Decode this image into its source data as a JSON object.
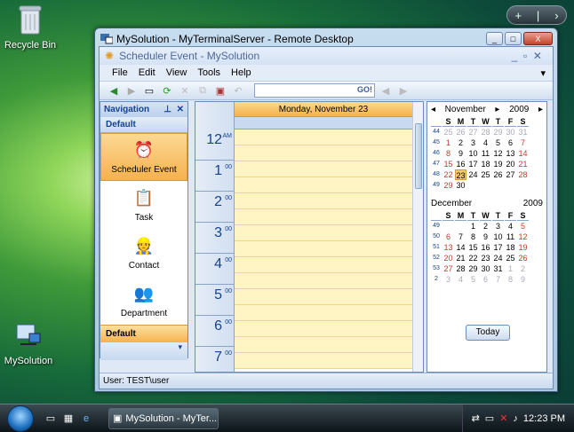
{
  "desktop": {
    "recycle_label": "Recycle Bin",
    "app_icon_label": "MySolution"
  },
  "gadget": {
    "add": "+",
    "sep": "|",
    "more": "›"
  },
  "rd_window": {
    "title": "MySolution - MyTerminalServer - Remote Desktop",
    "min": "_",
    "max": "□",
    "close": "X"
  },
  "app": {
    "title": "Scheduler Event - MySolution",
    "menu": [
      "File",
      "Edit",
      "View",
      "Tools",
      "Help"
    ],
    "search_go": "GO!",
    "status": "User: TEST\\user"
  },
  "navigation": {
    "title": "Navigation",
    "pin": "ᵖ",
    "close": "✕",
    "group": "Default",
    "group2": "Default",
    "items": [
      {
        "label": "Scheduler Event",
        "icon": "alarm-clock-icon"
      },
      {
        "label": "Task",
        "icon": "clipboard-icon"
      },
      {
        "label": "Contact",
        "icon": "person-icon"
      },
      {
        "label": "Department",
        "icon": "people-icon"
      }
    ]
  },
  "scheduler": {
    "day_header": "Monday, November 23",
    "hours": [
      {
        "h": "12",
        "s": "AM"
      },
      {
        "h": "1",
        "s": "00"
      },
      {
        "h": "2",
        "s": "00"
      },
      {
        "h": "3",
        "s": "00"
      },
      {
        "h": "4",
        "s": "00"
      },
      {
        "h": "5",
        "s": "00"
      },
      {
        "h": "6",
        "s": "00"
      },
      {
        "h": "7",
        "s": "00"
      }
    ]
  },
  "calendar": {
    "nov": {
      "month": "November",
      "year": "2009",
      "days": [
        "S",
        "M",
        "T",
        "W",
        "T",
        "F",
        "S"
      ],
      "weeks": [
        {
          "wk": "44",
          "d": [
            "25",
            "26",
            "27",
            "28",
            "29",
            "30",
            "31"
          ]
        },
        {
          "wk": "45",
          "d": [
            "1",
            "2",
            "3",
            "4",
            "5",
            "6",
            "7"
          ]
        },
        {
          "wk": "46",
          "d": [
            "8",
            "9",
            "10",
            "11",
            "12",
            "13",
            "14"
          ]
        },
        {
          "wk": "47",
          "d": [
            "15",
            "16",
            "17",
            "18",
            "19",
            "20",
            "21"
          ]
        },
        {
          "wk": "48",
          "d": [
            "22",
            "23",
            "24",
            "25",
            "26",
            "27",
            "28"
          ]
        },
        {
          "wk": "49",
          "d": [
            "29",
            "30",
            "",
            "",
            "",
            "",
            ""
          ]
        }
      ]
    },
    "dec": {
      "month": "December",
      "year": "2009",
      "days": [
        "S",
        "M",
        "T",
        "W",
        "T",
        "F",
        "S"
      ],
      "weeks": [
        {
          "wk": "49",
          "d": [
            "",
            "",
            "1",
            "2",
            "3",
            "4",
            "5"
          ]
        },
        {
          "wk": "50",
          "d": [
            "6",
            "7",
            "8",
            "9",
            "10",
            "11",
            "12"
          ]
        },
        {
          "wk": "51",
          "d": [
            "13",
            "14",
            "15",
            "16",
            "17",
            "18",
            "19"
          ]
        },
        {
          "wk": "52",
          "d": [
            "20",
            "21",
            "22",
            "23",
            "24",
            "25",
            "26"
          ]
        },
        {
          "wk": "53",
          "d": [
            "27",
            "28",
            "29",
            "30",
            "31",
            "1",
            "2"
          ]
        },
        {
          "wk": "2",
          "d": [
            "3",
            "4",
            "5",
            "6",
            "7",
            "8",
            "9"
          ]
        }
      ]
    },
    "today_label": "Today"
  },
  "taskbar": {
    "task_label": "MySolution - MyTer...",
    "time": "12:23 PM"
  }
}
